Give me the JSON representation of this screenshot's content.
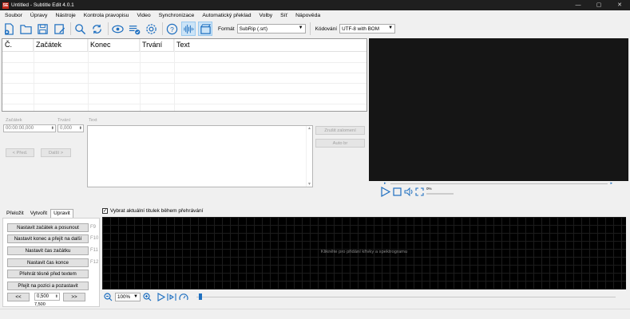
{
  "window": {
    "title": "Untitled - Subtitle Edit 4.0.1",
    "minimize": "—",
    "maximize": "▢",
    "close": "✕"
  },
  "menu": [
    "Soubor",
    "Úpravy",
    "Nástroje",
    "Kontrola pravopisu",
    "Video",
    "Synchronizace",
    "Automatický překlad",
    "Volby",
    "Síť",
    "Nápověda"
  ],
  "toolbar": {
    "format_label": "Formát",
    "format_value": "SubRip (.srt)",
    "encoding_label": "Kódování",
    "encoding_value": "UTF-8 with BOM"
  },
  "grid": {
    "columns": [
      "Č.",
      "Začátek",
      "Konec",
      "Trvání",
      "Text"
    ]
  },
  "editor": {
    "start_label": "Začátek",
    "start_value": "00:00:00,000",
    "duration_label": "Trvání",
    "duration_value": "0,000",
    "text_label": "Text",
    "prev": "< Před.",
    "next": "Další >",
    "unbreak": "Zrušit zalomení",
    "autobr": "Auto br"
  },
  "player": {
    "volume_label": "0%"
  },
  "tabs": [
    "Přeložit",
    "Vytvořit",
    "Upravit"
  ],
  "actions": [
    {
      "label": "Nastavit začátek a posunout",
      "key": "F9"
    },
    {
      "label": "Nastavit konec a přejít na další",
      "key": "F10"
    },
    {
      "label": "Nastavit čas začátku",
      "key": "F11"
    },
    {
      "label": "Nastavit čas konce",
      "key": "F12"
    },
    {
      "label": "Přehrát těsně před textem",
      "key": ""
    },
    {
      "label": "Přejít na pozici a pozastavit",
      "key": ""
    }
  ],
  "seek": {
    "back": "<<",
    "value": "0,500",
    "forward": ">>",
    "below": "7,500"
  },
  "waveform": {
    "select_current": "Vybrat aktuální titulek během přehrávání",
    "hint": "Klikněte pro přidání křivky a spektrogramu",
    "zoom": "100%"
  }
}
